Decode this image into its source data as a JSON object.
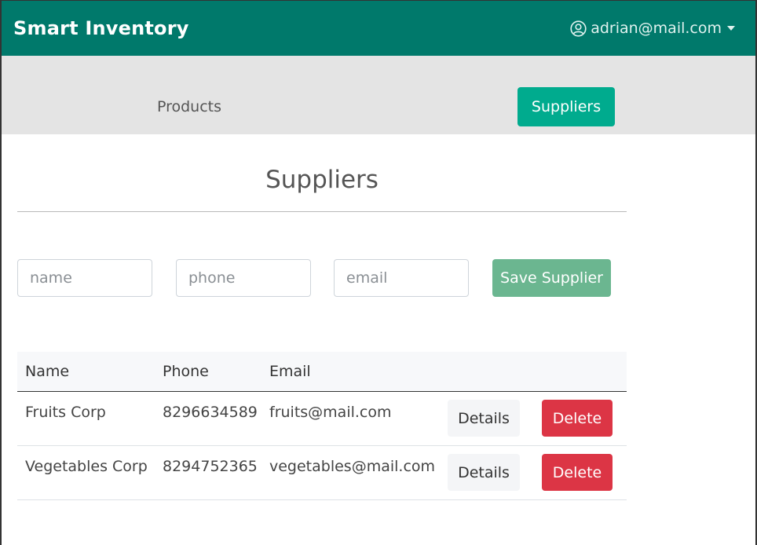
{
  "navbar": {
    "brand": "Smart Inventory",
    "user_email": "adrian@mail.com",
    "user_icon": "user-circle-icon"
  },
  "tabs": [
    {
      "label": "Products",
      "active": false
    },
    {
      "label": "Suppliers",
      "active": true
    }
  ],
  "page": {
    "title": "Suppliers"
  },
  "form": {
    "name_placeholder": "name",
    "phone_placeholder": "phone",
    "email_placeholder": "email",
    "name_value": "",
    "phone_value": "",
    "email_value": "",
    "save_label": "Save Supplier"
  },
  "table": {
    "headers": [
      "Name",
      "Phone",
      "Email"
    ],
    "rows": [
      {
        "name": "Fruits Corp",
        "phone": "8296634589",
        "email": "fruits@mail.com",
        "details_label": "Details",
        "delete_label": "Delete"
      },
      {
        "name": "Vegetables Corp",
        "phone": "8294752365",
        "email": "vegetables@mail.com",
        "details_label": "Details",
        "delete_label": "Delete"
      }
    ]
  },
  "colors": {
    "navbar": "#00796b",
    "active_tab": "#00ab8e",
    "save_button": "#6bb690",
    "delete_button": "#dc3545"
  }
}
